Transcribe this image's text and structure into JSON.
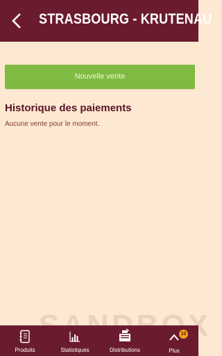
{
  "header": {
    "title": "STRASBOURG - KRUTENAU",
    "back_icon": "chevron-left-icon"
  },
  "actions": {
    "new_sale_label": "Nouvelle vente"
  },
  "history": {
    "title": "Historique des paiements",
    "empty_message": "Aucune vente pour le moment."
  },
  "watermark": "SANDBOX",
  "tabs": [
    {
      "label": "Produits",
      "icon": "book-icon"
    },
    {
      "label": "Statistiques",
      "icon": "bar-chart-icon"
    },
    {
      "label": "Distributions",
      "icon": "box-icon"
    },
    {
      "label": "Plus",
      "icon": "chevron-up-icon",
      "badge": "10"
    }
  ],
  "colors": {
    "primary": "#6b1b2e",
    "background": "#fde8d1",
    "accent_green": "#7fba42",
    "badge": "#f0a21a"
  }
}
